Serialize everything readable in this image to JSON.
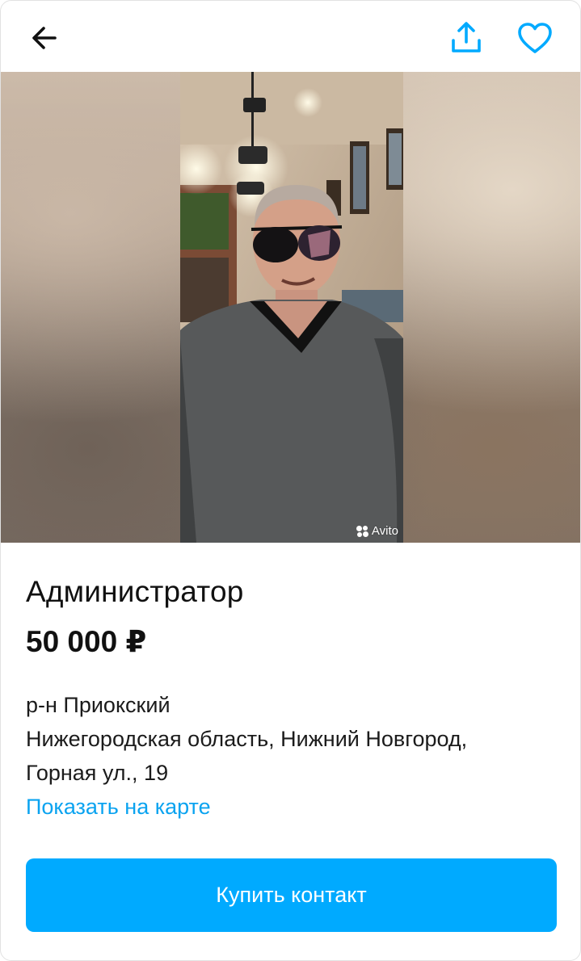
{
  "header": {
    "back_icon": "arrow-left-icon",
    "share_icon": "share-upload-icon",
    "favorite_icon": "heart-outline-icon",
    "accent_color": "#00aaff"
  },
  "gallery": {
    "watermark": "Avito"
  },
  "listing": {
    "title": "Администратор",
    "price": "50 000 ₽",
    "district": "р-н Приокский",
    "address_line1": "Нижегородская область, Нижний Новгород,",
    "address_line2": "Горная ул., 19",
    "map_link": "Показать на карте"
  },
  "actions": {
    "buy_contact": "Купить контакт",
    "button_color": "#00aaff"
  }
}
